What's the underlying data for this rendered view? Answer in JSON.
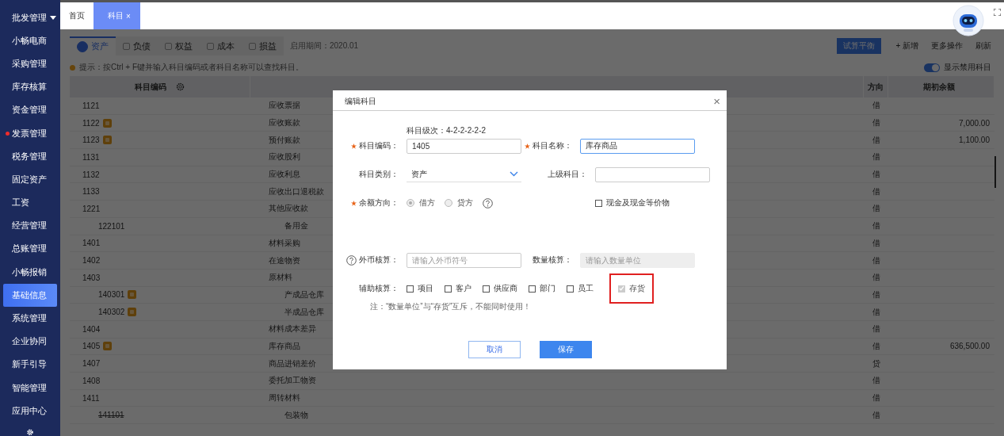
{
  "sidebar": {
    "items": [
      {
        "label": "批发管理",
        "selected": false,
        "expanded": true,
        "alert": false
      },
      {
        "label": "小畅电商",
        "selected": false,
        "alert": false
      },
      {
        "label": "采购管理",
        "selected": false,
        "alert": false
      },
      {
        "label": "库存核算",
        "selected": false,
        "alert": false
      },
      {
        "label": "资金管理",
        "selected": false,
        "alert": false
      },
      {
        "label": "发票管理",
        "selected": false,
        "alert": true
      },
      {
        "label": "税务管理",
        "selected": false,
        "alert": false
      },
      {
        "label": "固定资产",
        "selected": false,
        "alert": false
      },
      {
        "label": "工资",
        "selected": false,
        "alert": false
      },
      {
        "label": "经营管理",
        "selected": false,
        "alert": false
      },
      {
        "label": "总账管理",
        "selected": false,
        "alert": false
      },
      {
        "label": "小畅报销",
        "selected": false,
        "alert": false
      },
      {
        "label": "基础信息",
        "selected": true,
        "alert": false
      },
      {
        "label": "系统管理",
        "selected": false,
        "alert": false
      },
      {
        "label": "企业协同",
        "selected": false,
        "alert": false
      },
      {
        "label": "新手引导",
        "selected": false,
        "alert": false
      },
      {
        "label": "智能管理",
        "selected": false,
        "alert": false
      },
      {
        "label": "应用中心",
        "selected": false,
        "alert": false
      }
    ]
  },
  "page_tabs": [
    {
      "label": "首页",
      "selected": false,
      "closable": false
    },
    {
      "label": "科目",
      "selected": true,
      "closable": true,
      "close": "×"
    }
  ],
  "category_tabs": [
    {
      "label": "资产",
      "selected": true
    },
    {
      "label": "负债",
      "selected": false
    },
    {
      "label": "权益",
      "selected": false
    },
    {
      "label": "成本",
      "selected": false
    },
    {
      "label": "损益",
      "selected": false
    }
  ],
  "period": "启用期间：2020.01",
  "toolbar": {
    "primary": "试算平衡",
    "add": "+ 新增",
    "more": "更多操作",
    "refresh": "刷新"
  },
  "hint": "提示：按Ctrl + F键并输入科目编码或者科目名称可以查找科目。",
  "show_disabled": {
    "label": "显示禁用科目",
    "on": true
  },
  "table": {
    "columns": [
      "科目编码",
      "方向",
      "期初余额"
    ],
    "rows": [
      {
        "code": "1121",
        "name": "应收票据",
        "direction": "借",
        "tagged": false,
        "disabled": false
      },
      {
        "code": "1122",
        "name": "应收账款",
        "direction": "借",
        "balance": "7,000.00",
        "tagged": true,
        "disabled": false
      },
      {
        "code": "1123",
        "name": "预付账款",
        "direction": "借",
        "balance": "1,100.00",
        "tagged": true,
        "disabled": false
      },
      {
        "code": "1131",
        "name": "应收股利",
        "direction": "借",
        "tagged": false,
        "disabled": false
      },
      {
        "code": "1132",
        "name": "应收利息",
        "direction": "借",
        "tagged": false,
        "disabled": false
      },
      {
        "code": "1133",
        "name": "应收出口退税款",
        "direction": "借",
        "tagged": false,
        "disabled": false
      },
      {
        "code": "1221",
        "name": "其他应收款",
        "direction": "借",
        "tagged": false,
        "disabled": false,
        "children": [
          {
            "code": "122101",
            "name": "备用金",
            "direction": "借",
            "tagged": false,
            "disabled": false
          }
        ]
      },
      {
        "code": "1401",
        "name": "材料采购",
        "direction": "借",
        "tagged": false,
        "disabled": false
      },
      {
        "code": "1402",
        "name": "在途物资",
        "direction": "借",
        "tagged": false,
        "disabled": false
      },
      {
        "code": "1403",
        "name": "原材料",
        "direction": "借",
        "tagged": false,
        "disabled": false,
        "children": [
          {
            "code": "140301",
            "name": "产成品仓库",
            "direction": "借",
            "tagged": true,
            "disabled": false
          },
          {
            "code": "140302",
            "name": "半成品仓库",
            "direction": "借",
            "tagged": true,
            "disabled": false
          }
        ]
      },
      {
        "code": "1404",
        "name": "材料成本差异",
        "direction": "借",
        "tagged": false,
        "disabled": false
      },
      {
        "code": "1405",
        "name": "库存商品",
        "direction": "借",
        "balance": "636,500.00",
        "tagged": true,
        "disabled": false
      },
      {
        "code": "1407",
        "name": "商品进销差价",
        "direction": "贷",
        "tagged": false,
        "disabled": false
      },
      {
        "code": "1408",
        "name": "委托加工物资",
        "direction": "借",
        "tagged": false,
        "disabled": false
      },
      {
        "code": "1411",
        "name": "周转材料",
        "direction": "借",
        "tagged": false,
        "disabled": false,
        "children": [
          {
            "code": "141101",
            "name": "包装物",
            "direction": "借",
            "tagged": false,
            "disabled": true
          }
        ]
      }
    ]
  },
  "modal": {
    "title": "编辑科目",
    "close": "×",
    "level": "科目级次：4-2-2-2-2-2",
    "code": {
      "label": "科目编码：",
      "required": true,
      "value": "1405"
    },
    "name": {
      "label": "科目名称：",
      "required": true,
      "value": "库存商品",
      "focused": true
    },
    "category": {
      "label": "科目类别：",
      "value": "资产"
    },
    "parent": {
      "label": "上级科目："
    },
    "direction": {
      "label": "余额方向：",
      "required": true,
      "options": [
        {
          "label": "借方",
          "selected": true,
          "disabled": true
        },
        {
          "label": "贷方",
          "selected": false,
          "disabled": true
        }
      ]
    },
    "cash": {
      "label": "现金及现金等价物",
      "checked": false
    },
    "currency": {
      "label": "外币核算：",
      "placeholder": "请输入外币符号"
    },
    "quantity": {
      "label": "数量核算：",
      "placeholder": "请输入数量单位",
      "disabled": true
    },
    "auxiliary": {
      "label": "辅助核算：",
      "options": [
        {
          "label": "项目",
          "checked": false,
          "disabled": false,
          "highlighted": false
        },
        {
          "label": "客户",
          "checked": false,
          "disabled": false,
          "highlighted": false
        },
        {
          "label": "供应商",
          "checked": false,
          "disabled": false,
          "highlighted": false
        },
        {
          "label": "部门",
          "checked": false,
          "disabled": false,
          "highlighted": false
        },
        {
          "label": "员工",
          "checked": false,
          "disabled": false,
          "highlighted": false
        },
        {
          "label": "存货",
          "checked": true,
          "disabled": true,
          "highlighted": true
        }
      ]
    },
    "note": "注：“数量单位”与“存货”互斥，不能同时使用！",
    "cancel": "取消",
    "save": "保存"
  }
}
